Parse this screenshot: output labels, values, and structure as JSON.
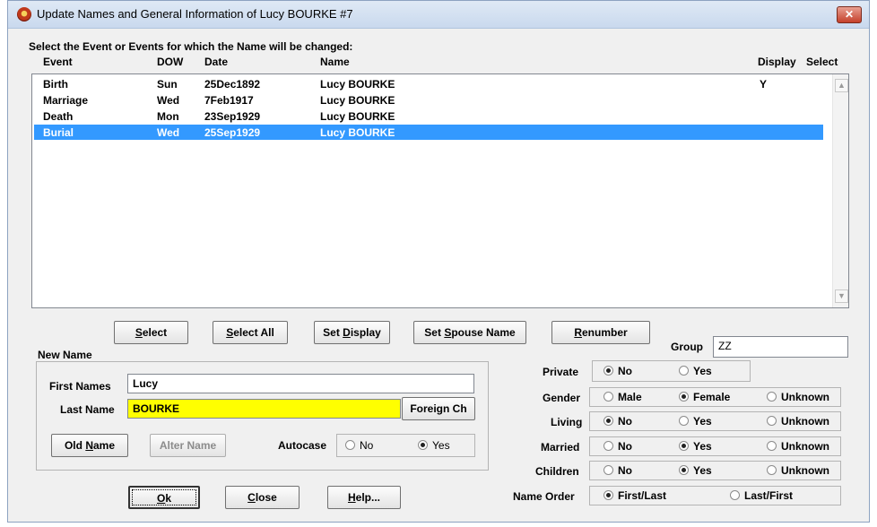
{
  "window": {
    "title": "Update Names and General Information of Lucy BOURKE #7",
    "close_glyph": "✕"
  },
  "instructions": "Select the Event or Events for which the Name will be changed:",
  "list": {
    "headers": {
      "event": "Event",
      "dow": "DOW",
      "date": "Date",
      "name": "Name",
      "display": "Display",
      "select": "Select"
    },
    "rows": [
      {
        "event": "Birth",
        "dow": "Sun",
        "date": "25Dec1892",
        "name": "Lucy BOURKE",
        "display": "Y",
        "selected": false
      },
      {
        "event": "Marriage",
        "dow": "Wed",
        "date": "7Feb1917",
        "name": "Lucy BOURKE",
        "display": "",
        "selected": false
      },
      {
        "event": "Death",
        "dow": "Mon",
        "date": "23Sep1929",
        "name": "Lucy BOURKE",
        "display": "",
        "selected": false
      },
      {
        "event": "Burial",
        "dow": "Wed",
        "date": "25Sep1929",
        "name": "Lucy BOURKE",
        "display": "",
        "selected": true
      }
    ]
  },
  "buttons": {
    "select": {
      "pre": "",
      "key": "S",
      "post": "elect"
    },
    "select_all": {
      "pre": "",
      "key": "S",
      "post": "elect All"
    },
    "set_display": {
      "pre": "Set ",
      "key": "D",
      "post": "isplay"
    },
    "set_spouse": {
      "pre": "Set ",
      "key": "S",
      "post": "pouse Name"
    },
    "renumber": {
      "pre": "",
      "key": "R",
      "post": "enumber"
    },
    "foreign": "Foreign Ch",
    "old_name": {
      "pre": "Old ",
      "key": "N",
      "post": "ame"
    },
    "alter_name": "Alter Name",
    "ok": {
      "pre": "",
      "key": "O",
      "post": "k"
    },
    "close": {
      "pre": "",
      "key": "C",
      "post": "lose"
    },
    "help": {
      "pre": "",
      "key": "H",
      "post": "elp..."
    }
  },
  "new_name": {
    "legend": "New Name",
    "first_label": "First Names",
    "first_value": "Lucy",
    "last_label": "Last Name",
    "last_value": "BOURKE",
    "autocase_label": "Autocase",
    "autocase_no": "No",
    "autocase_yes": "Yes",
    "autocase_selected": "yes"
  },
  "group": {
    "label": "Group",
    "value": "ZZ"
  },
  "options": {
    "private": {
      "label": "Private",
      "no": "No",
      "yes": "Yes",
      "selected": "no"
    },
    "gender": {
      "label": "Gender",
      "male": "Male",
      "female": "Female",
      "unknown": "Unknown",
      "selected": "female"
    },
    "living": {
      "label": "Living",
      "no": "No",
      "yes": "Yes",
      "unknown": "Unknown",
      "selected": "no"
    },
    "married": {
      "label": "Married",
      "no": "No",
      "yes": "Yes",
      "unknown": "Unknown",
      "selected": "yes"
    },
    "children": {
      "label": "Children",
      "no": "No",
      "yes": "Yes",
      "unknown": "Unknown",
      "selected": "yes"
    },
    "name_order": {
      "label": "Name Order",
      "first_last": "First/Last",
      "last_first": "Last/First",
      "selected": "first_last"
    }
  }
}
